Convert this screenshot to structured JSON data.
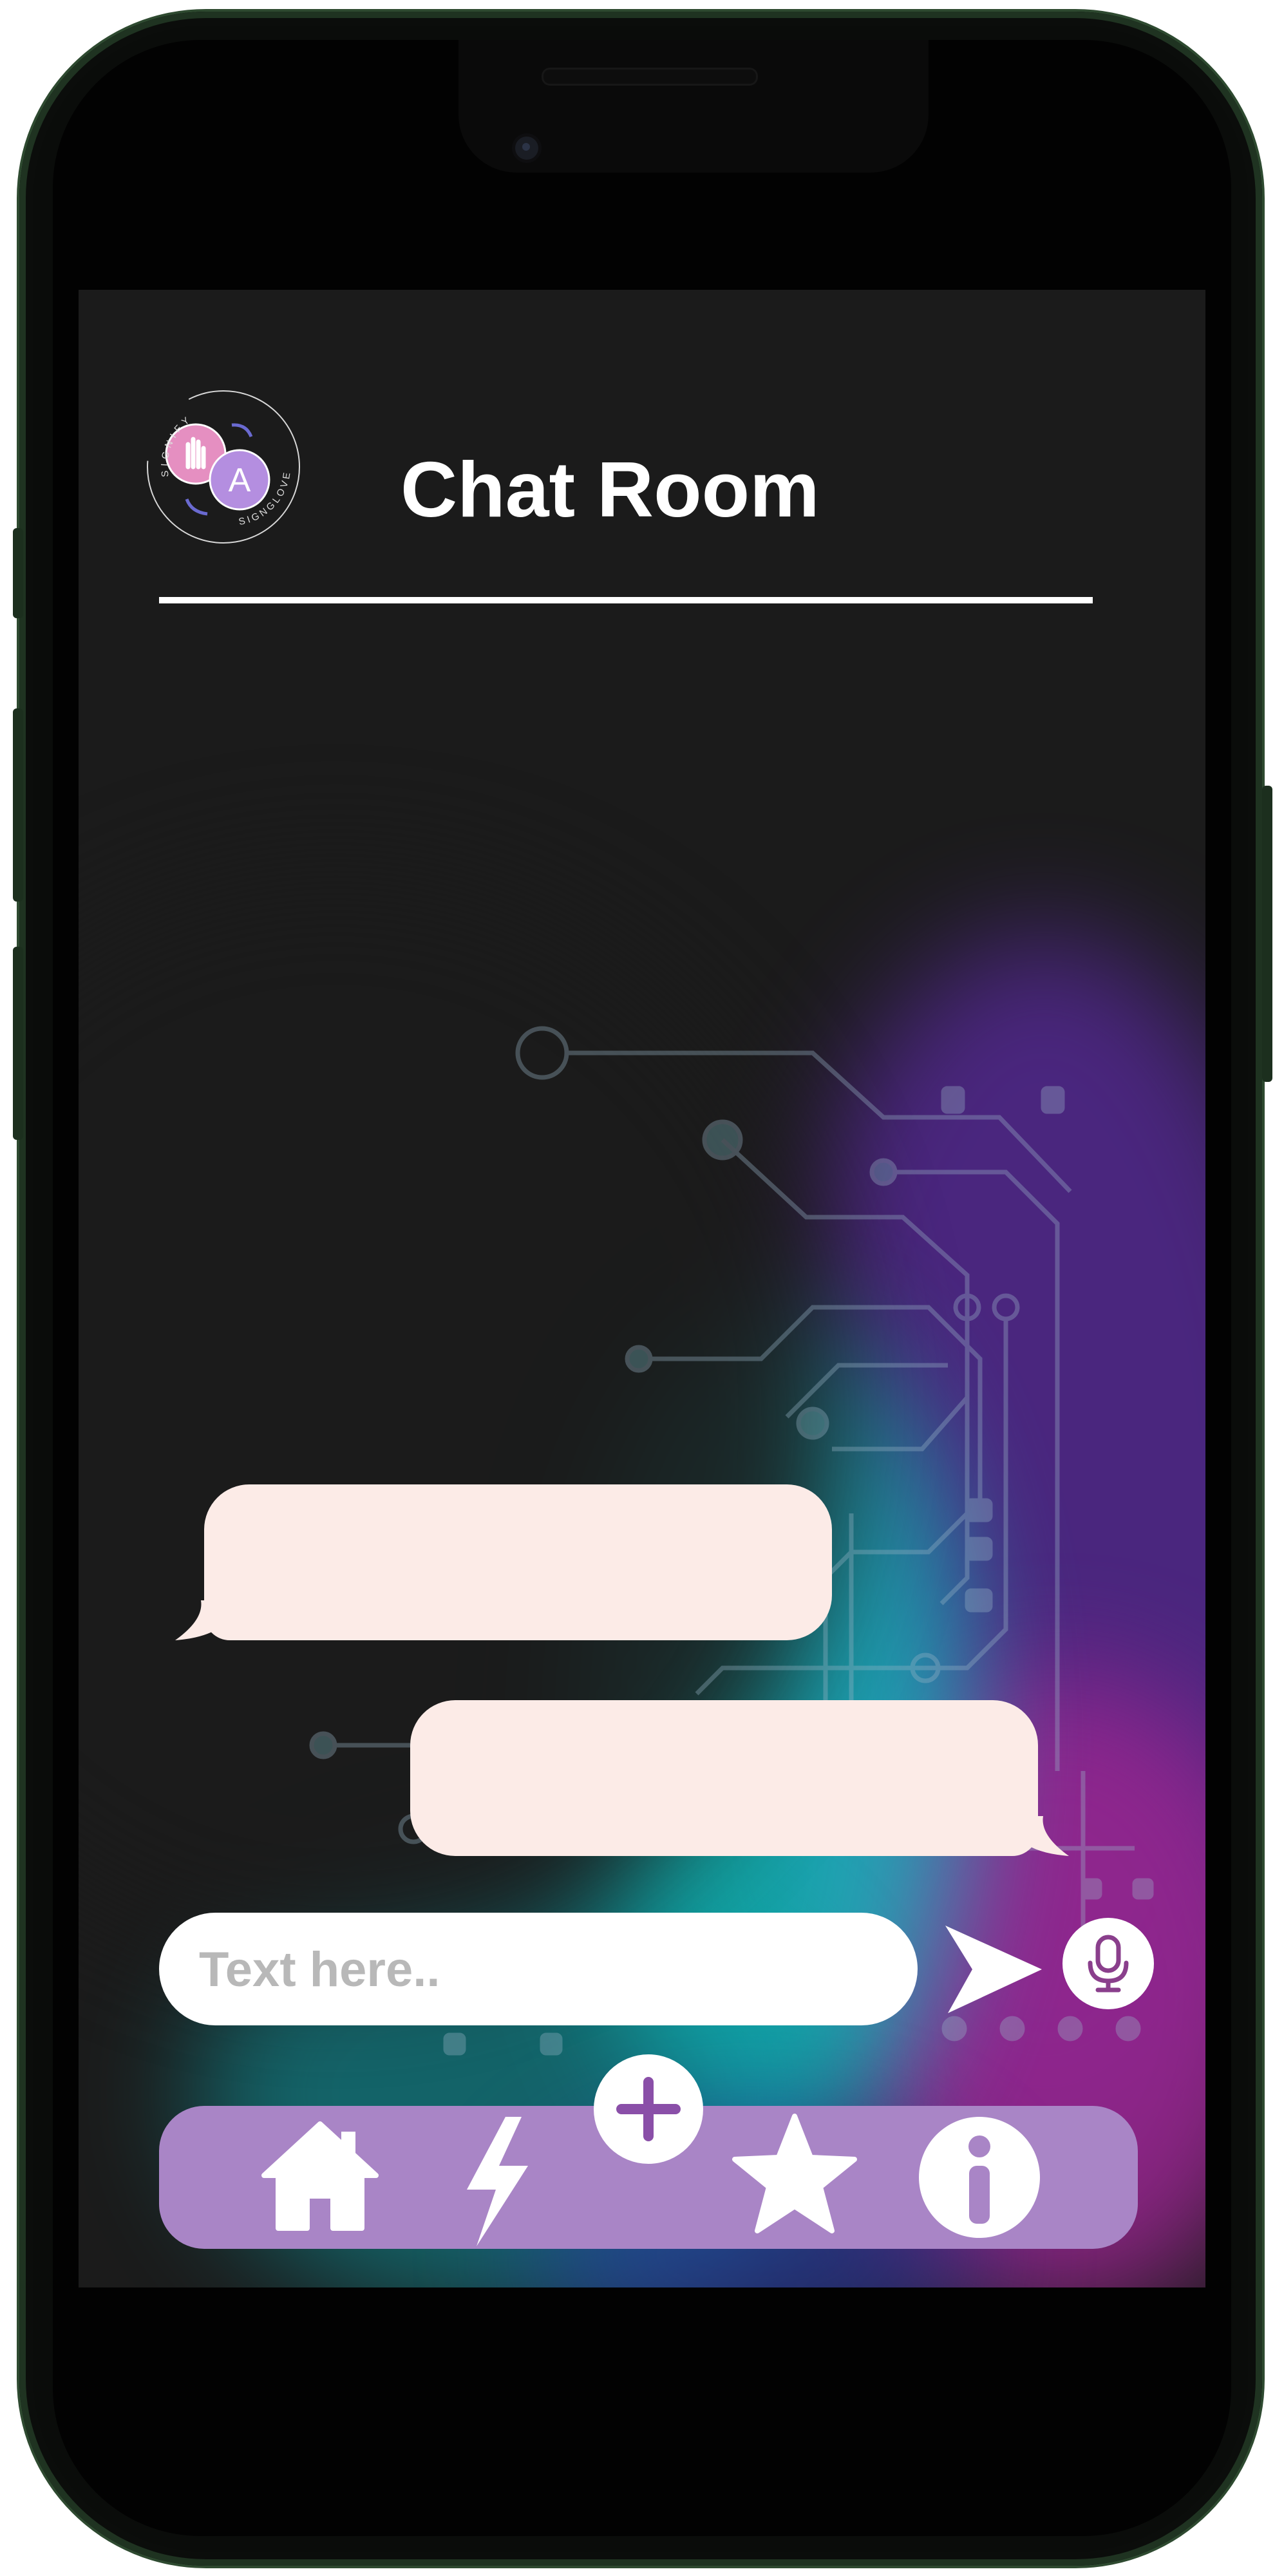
{
  "app": {
    "title": "Chat Room",
    "logo": {
      "ring_text_top": "SIGNIFY",
      "ring_text_bottom": "SIGNGLOVE",
      "letter": "A"
    }
  },
  "chat": {
    "messages": [
      {
        "side": "left",
        "text": ""
      },
      {
        "side": "right",
        "text": ""
      }
    ]
  },
  "composer": {
    "placeholder": "Text here..",
    "value": "",
    "send_icon": "send-icon",
    "mic_icon": "microphone-icon"
  },
  "nav": {
    "items": [
      {
        "icon": "home-icon"
      },
      {
        "icon": "lightning-icon"
      },
      {
        "icon": "plus-icon"
      },
      {
        "icon": "star-icon"
      },
      {
        "icon": "info-icon"
      }
    ]
  },
  "colors": {
    "background": "#1b1b1b",
    "bubble": "#fcebe7",
    "nav_bar": "#a985c6",
    "accent_purple": "#8a4fa8",
    "accent_teal": "#18d6d0",
    "accent_magenta": "#a62a8f"
  }
}
